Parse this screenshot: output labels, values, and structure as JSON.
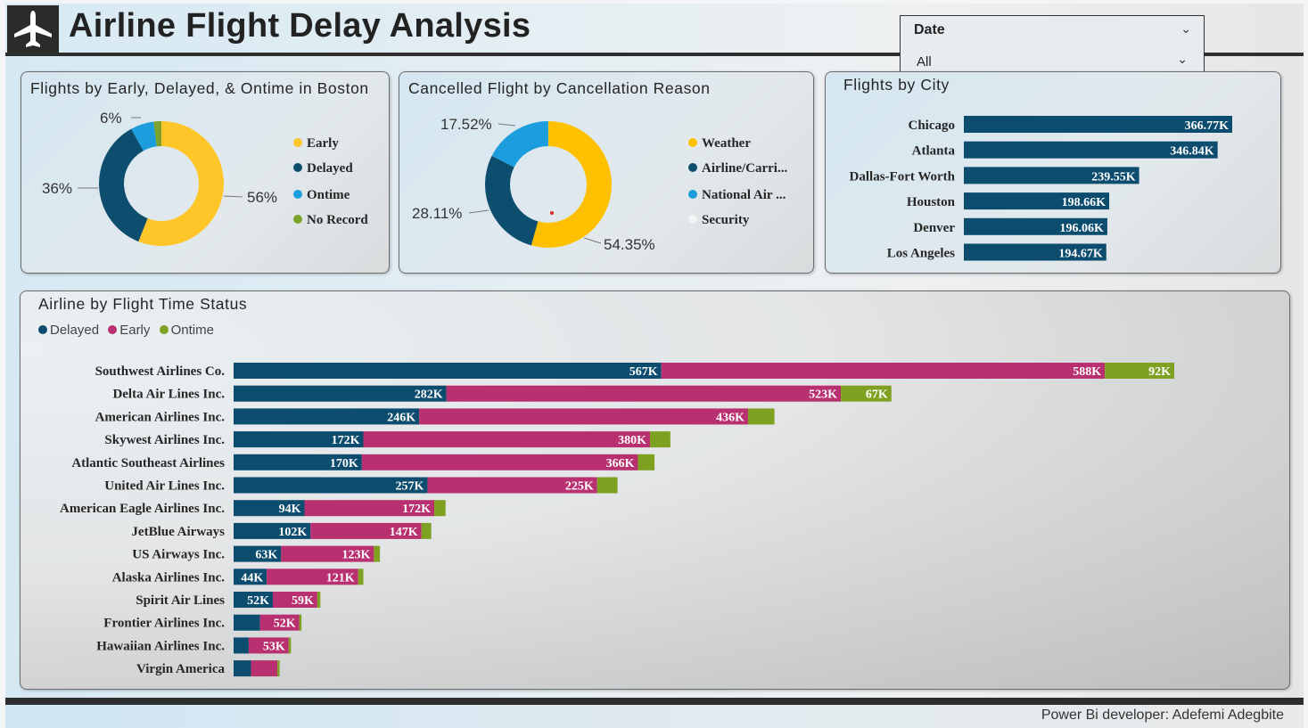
{
  "header": {
    "title": "Airline Flight Delay Analysis",
    "logo_icon": "airplane-icon"
  },
  "slicer": {
    "label": "Date",
    "value": "All"
  },
  "boston_card": {
    "title": "Flights by Early, Delayed, & Ontime in Boston",
    "legend": [
      "Early",
      "Delayed",
      "Ontime",
      "No Record"
    ],
    "labels": {
      "early": "56%",
      "delayed": "36%",
      "ontime": "6%"
    }
  },
  "cancel_card": {
    "title": "Cancelled Flight by Cancellation Reason",
    "legend": [
      "Weather",
      "Airline/Carri...",
      "National Air ...",
      "Security"
    ],
    "labels": {
      "weather": "54.35%",
      "airline": "28.11%",
      "national": "17.52%"
    }
  },
  "city_card": {
    "title": "Flights by City"
  },
  "airline_card": {
    "title": "Airline by Flight Time Status",
    "legend": [
      "Delayed",
      "Early",
      "Ontime"
    ]
  },
  "footer": {
    "credit": "Power Bi developer: Adefemi Adegbite"
  },
  "colors": {
    "early_yellow": "#FFC629",
    "delayed_navy": "#0D4D6E",
    "ontime_blue": "#1C9DDD",
    "norecord_green": "#7BA22B",
    "bar_navy": "#0C4C6E",
    "bar_magenta": "#B8306F",
    "bar_green": "#7FA122"
  },
  "chart_data": [
    {
      "type": "pie",
      "title": "Flights by Early, Delayed, & Ontime in Boston",
      "series": [
        {
          "name": "",
          "values": [
            56,
            36,
            6,
            2
          ]
        }
      ],
      "categories": [
        "Early",
        "Delayed",
        "Ontime",
        "No Record"
      ],
      "slice_labels": [
        "56%",
        "36%",
        "6%",
        ""
      ],
      "legend": "right"
    },
    {
      "type": "pie",
      "title": "Cancelled Flight by Cancellation Reason",
      "categories": [
        "Weather",
        "Airline/Carri...",
        "National Air ...",
        "Security"
      ],
      "values": [
        54.35,
        28.11,
        17.52,
        0.02
      ],
      "slice_labels": [
        "54.35%",
        "28.11%",
        "17.52%",
        ""
      ],
      "legend": "right"
    },
    {
      "type": "bar",
      "title": "Flights by City",
      "categories": [
        "Chicago",
        "Atlanta",
        "Dallas-Fort Worth",
        "Houston",
        "Denver",
        "Los Angeles"
      ],
      "values": [
        366.77,
        346.84,
        239.55,
        198.66,
        196.06,
        194.67
      ],
      "value_labels": [
        "366.77K",
        "346.84K",
        "239.55K",
        "198.66K",
        "196.06K",
        "194.67K"
      ],
      "unit": "K",
      "orientation": "horizontal"
    },
    {
      "type": "bar",
      "stacked": true,
      "orientation": "horizontal",
      "title": "Airline by Flight Time Status",
      "legend": "top-left",
      "categories": [
        "Southwest Airlines Co.",
        "Delta Air Lines Inc.",
        "American Airlines Inc.",
        "Skywest Airlines Inc.",
        "Atlantic Southeast Airlines",
        "United Air Lines Inc.",
        "American Eagle Airlines Inc.",
        "JetBlue Airways",
        "US Airways Inc.",
        "Alaska Airlines Inc.",
        "Spirit Air Lines",
        "Frontier Airlines Inc.",
        "Hawaiian Airlines Inc.",
        "Virgin America"
      ],
      "series": [
        {
          "name": "Delayed",
          "values": [
            567,
            282,
            246,
            172,
            170,
            257,
            94,
            102,
            63,
            44,
            52,
            35,
            20,
            23
          ],
          "labels": [
            "567K",
            "282K",
            "246K",
            "172K",
            "170K",
            "257K",
            "94K",
            "102K",
            "63K",
            "44K",
            "52K",
            "",
            "",
            ""
          ]
        },
        {
          "name": "Early",
          "values": [
            588,
            523,
            436,
            380,
            366,
            225,
            172,
            147,
            123,
            121,
            59,
            52,
            53,
            35
          ],
          "labels": [
            "588K",
            "523K",
            "436K",
            "380K",
            "366K",
            "225K",
            "172K",
            "147K",
            "123K",
            "121K",
            "59K",
            "52K",
            "53K",
            ""
          ]
        },
        {
          "name": "Ontime",
          "values": [
            92,
            67,
            35,
            27,
            22,
            27,
            15,
            13,
            8,
            7,
            4,
            3,
            3,
            3
          ],
          "labels": [
            "92K",
            "67K",
            "",
            "",
            "",
            "",
            "",
            "",
            "",
            "",
            "",
            "",
            "",
            ""
          ]
        }
      ],
      "unit": "K"
    }
  ]
}
